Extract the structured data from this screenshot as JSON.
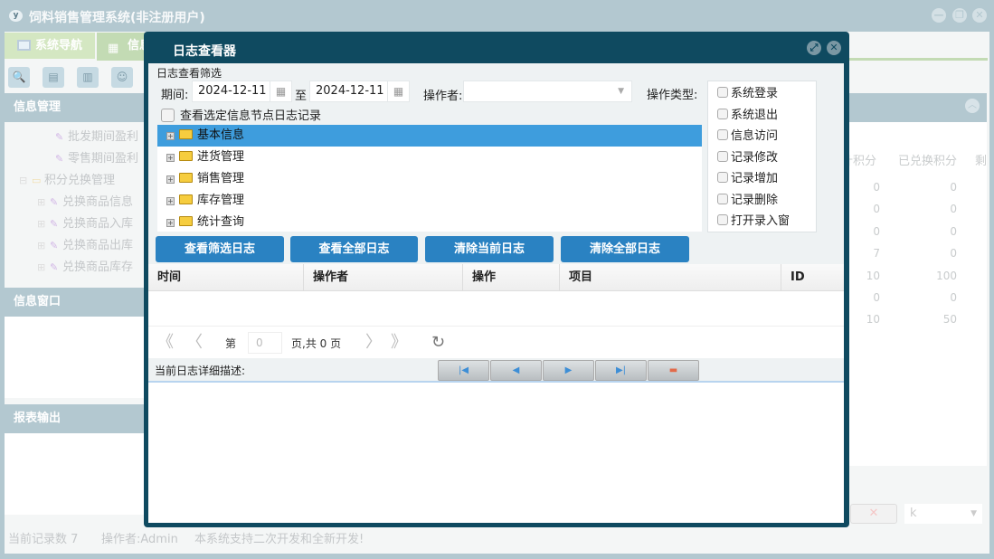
{
  "app": {
    "title": "饲料销售管理系统(非注册用户)",
    "logo": "yF"
  },
  "window_controls": [
    "minimize-icon",
    "restore-icon",
    "close-icon"
  ],
  "tabs": [
    {
      "label": "系统导航",
      "active": true
    },
    {
      "label": "信息"
    }
  ],
  "toolbar_icons": [
    "search-icon",
    "list-icon",
    "document-icon",
    "user-icon"
  ],
  "sidebar": {
    "info_panel": "信息管理",
    "tree": [
      {
        "label": "批发期间盈利",
        "level": 2
      },
      {
        "label": "零售期间盈利",
        "level": 2
      },
      {
        "label": "积分兑换管理",
        "level": 1
      },
      {
        "label": "兑换商品信息",
        "level": 2
      },
      {
        "label": "兑换商品入库",
        "level": 2
      },
      {
        "label": "兑换商品出库",
        "level": 2
      },
      {
        "label": "兑换商品库存",
        "level": 2
      }
    ],
    "window_panel": "信息窗口",
    "report_panel": "报表输出"
  },
  "bg_grid": {
    "headers": [
      "计积分",
      "已兑换积分",
      "剩"
    ],
    "rows": [
      [
        "0",
        "0"
      ],
      [
        "0",
        "0"
      ],
      [
        "0",
        "0"
      ],
      [
        "7",
        "0"
      ],
      [
        "10",
        "100"
      ],
      [
        "0",
        "0"
      ],
      [
        "10",
        "50"
      ]
    ],
    "combo_value": "k"
  },
  "status": {
    "records": "当前记录数 7",
    "operator": "操作者:Admin",
    "note": "本系统支持二次开发和全新开发!"
  },
  "dialog": {
    "title": "日志查看器",
    "filter_title": "日志查看筛选",
    "period_label": "期间:",
    "date_from": "2024-12-11",
    "to_label": "至",
    "date_to": "2024-12-11",
    "operator_label": "操作者:",
    "operator_value": "",
    "optype_label": "操作类型:",
    "optypes": [
      "系统登录",
      "系统退出",
      "信息访问",
      "记录修改",
      "记录增加",
      "记录删除",
      "打开录入窗"
    ],
    "node_check_label": "查看选定信息节点日志记录",
    "tree": [
      {
        "label": "基本信息",
        "selected": true
      },
      {
        "label": "进货管理"
      },
      {
        "label": "销售管理"
      },
      {
        "label": "库存管理"
      },
      {
        "label": "统计查询"
      }
    ],
    "buttons": [
      "查看筛选日志",
      "查看全部日志",
      "清除当前日志",
      "清除全部日志"
    ],
    "columns": [
      "时间",
      "操作者",
      "操作",
      "项目",
      "ID"
    ],
    "pager": {
      "page_prefix": "第",
      "page_value": "0",
      "page_suffix": "页,共 0 页"
    },
    "desc_label": "当前日志详细描述:",
    "nav_buttons": [
      "first-icon",
      "prev-icon",
      "next-icon",
      "last-icon",
      "minus-icon"
    ]
  }
}
